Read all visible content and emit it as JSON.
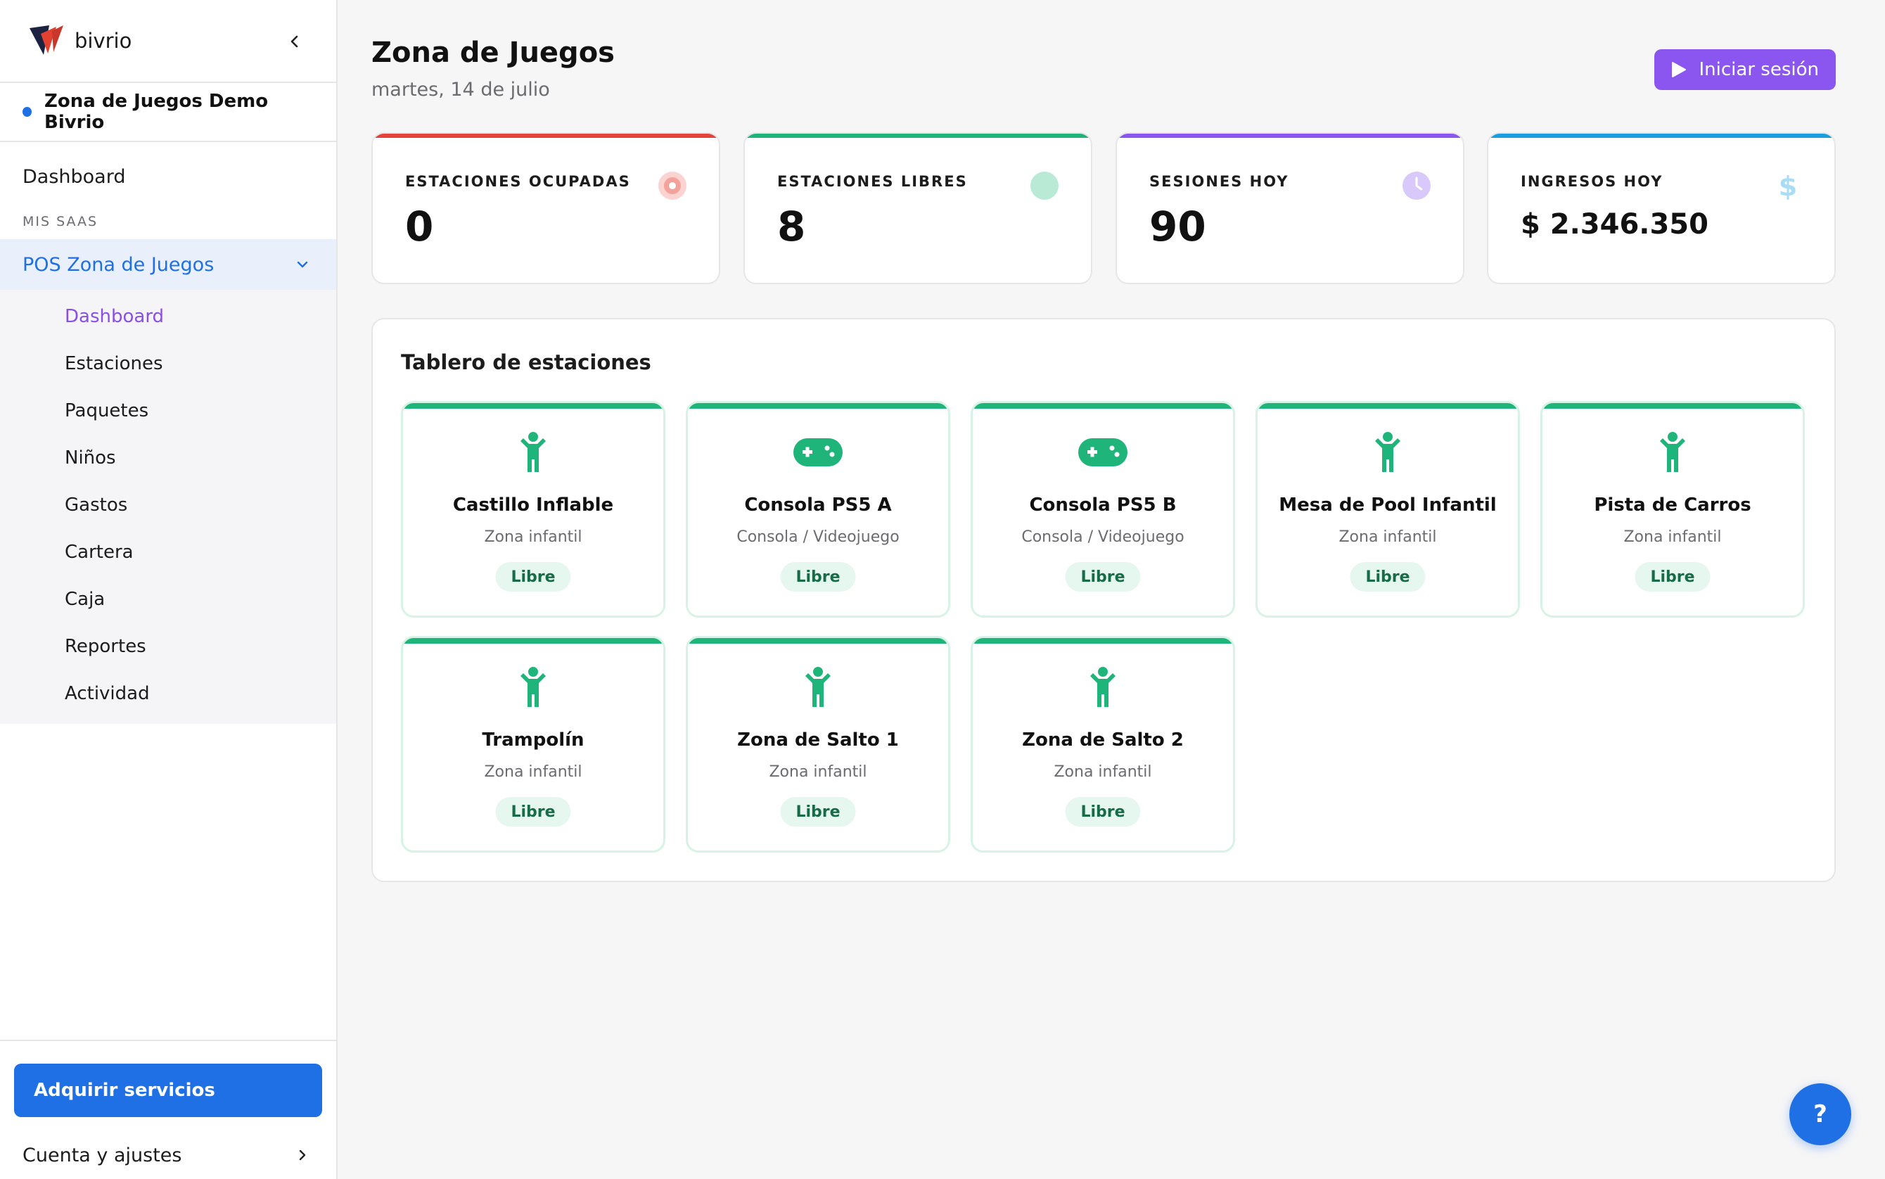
{
  "sidebar": {
    "brand": "bivrio",
    "workspace": "Zona de Juegos Demo Bivrio",
    "dashboard_label": "Dashboard",
    "section_label": "MIS SAAS",
    "saas_title": "POS Zona de Juegos",
    "items": [
      {
        "label": "Dashboard",
        "active": true
      },
      {
        "label": "Estaciones"
      },
      {
        "label": "Paquetes"
      },
      {
        "label": "Niños"
      },
      {
        "label": "Gastos"
      },
      {
        "label": "Cartera"
      },
      {
        "label": "Caja"
      },
      {
        "label": "Reportes"
      },
      {
        "label": "Actividad"
      }
    ],
    "acquire_label": "Adquirir servicios",
    "account_label": "Cuenta y ajustes"
  },
  "header": {
    "title": "Zona de Juegos",
    "date": "martes, 14 de julio",
    "login_label": "Iniciar sesión"
  },
  "stats": [
    {
      "label": "ESTACIONES OCUPADAS",
      "value": "0",
      "color": "#e4433a",
      "icon": "record-icon"
    },
    {
      "label": "ESTACIONES LIBRES",
      "value": "8",
      "color": "#1fb57a",
      "icon": "circle-icon"
    },
    {
      "label": "SESIONES HOY",
      "value": "90",
      "color": "#8b55f0",
      "icon": "clock-icon"
    },
    {
      "label": "INGRESOS HOY",
      "value": "$ 2.346.350",
      "color": "#1a9ee0",
      "icon": "dollar-icon"
    }
  ],
  "board": {
    "title": "Tablero de estaciones",
    "stations": [
      {
        "name": "Castillo Inflable",
        "type": "Zona infantil",
        "status": "Libre",
        "icon": "child-icon"
      },
      {
        "name": "Consola PS5 A",
        "type": "Consola / Videojuego",
        "status": "Libre",
        "icon": "gamepad-icon"
      },
      {
        "name": "Consola PS5 B",
        "type": "Consola / Videojuego",
        "status": "Libre",
        "icon": "gamepad-icon"
      },
      {
        "name": "Mesa de Pool Infantil",
        "type": "Zona infantil",
        "status": "Libre",
        "icon": "child-icon"
      },
      {
        "name": "Pista de Carros",
        "type": "Zona infantil",
        "status": "Libre",
        "icon": "child-icon"
      },
      {
        "name": "Trampolín",
        "type": "Zona infantil",
        "status": "Libre",
        "icon": "child-icon"
      },
      {
        "name": "Zona de Salto 1",
        "type": "Zona infantil",
        "status": "Libre",
        "icon": "child-icon"
      },
      {
        "name": "Zona de Salto 2",
        "type": "Zona infantil",
        "status": "Libre",
        "icon": "child-icon"
      }
    ]
  },
  "help_label": "?",
  "colors": {
    "accent_blue": "#1f6fe5",
    "accent_purple": "#8b55f0",
    "free_green": "#1fb57a"
  }
}
